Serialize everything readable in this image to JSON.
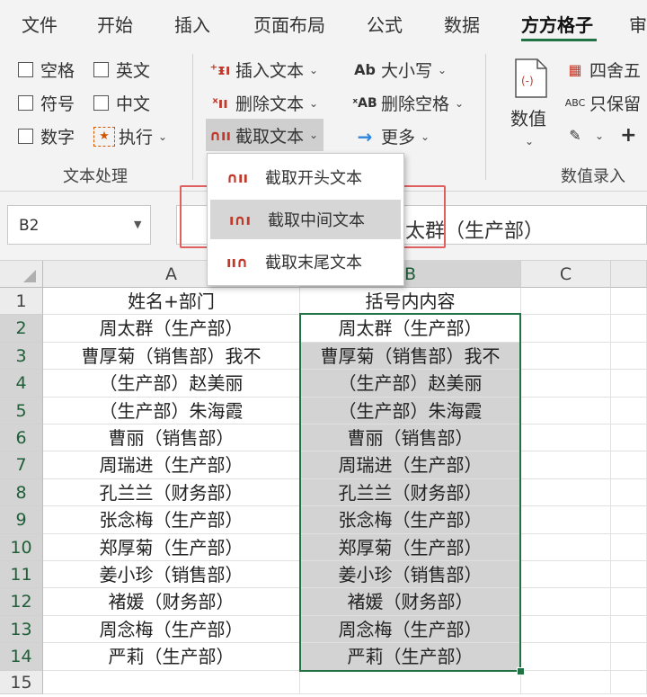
{
  "menu_tabs": [
    "文件",
    "开始",
    "插入",
    "页面布局",
    "公式",
    "数据",
    "方方格子",
    "审"
  ],
  "active_tab": "方方格子",
  "ribbon": {
    "checkboxes": [
      {
        "label": "空格"
      },
      {
        "label": "英文"
      },
      {
        "label": "符号"
      },
      {
        "label": "中文"
      },
      {
        "label": "数字"
      }
    ],
    "execute_label": "执行",
    "insert_text": "插入文本",
    "delete_text": "删除文本",
    "extract_text": "截取文本",
    "case_label": "大小写",
    "delete_space": "删除空格",
    "more_label": "更多",
    "value_label": "数值",
    "round_label": "四舍五",
    "keep_label": "只保留",
    "group_text_processing": "文本处理",
    "group_value_entry": "数值录入"
  },
  "dropdown": {
    "items": [
      "截取开头文本",
      "截取中间文本",
      "截取末尾文本"
    ],
    "hovered": "截取中间文本"
  },
  "formula_bar": {
    "cell_ref": "B2",
    "content": "太群（生产部）"
  },
  "grid": {
    "columns": [
      "A",
      "B",
      "C"
    ],
    "row_numbers": [
      "1",
      "2",
      "3",
      "4",
      "5",
      "6",
      "7",
      "8",
      "9",
      "10",
      "11",
      "12",
      "13",
      "14",
      "15"
    ],
    "col_a": [
      "姓名+部门",
      "周太群（生产部）",
      "曹厚菊（销售部）我不",
      "（生产部）赵美丽",
      "（生产部）朱海霞",
      "曹丽（销售部）",
      "周瑞进（生产部）",
      "孔兰兰（财务部）",
      "张念梅（生产部）",
      "郑厚菊（生产部）",
      "姜小珍（销售部）",
      "褚媛（财务部）",
      "周念梅（生产部）",
      "严莉（生产部）",
      ""
    ],
    "col_b": [
      "括号内内容",
      "周太群（生产部）",
      "曹厚菊（销售部）我不",
      "（生产部）赵美丽",
      "（生产部）朱海霞",
      "曹丽（销售部）",
      "周瑞进（生产部）",
      "孔兰兰（财务部）",
      "张念梅（生产部）",
      "郑厚菊（生产部）",
      "姜小珍（销售部）",
      "褚媛（财务部）",
      "周念梅（生产部）",
      "严莉（生产部）",
      ""
    ]
  },
  "colors": {
    "accent": "#217346",
    "selection_fill": "#d3d3d3",
    "callout": "#e06060"
  }
}
